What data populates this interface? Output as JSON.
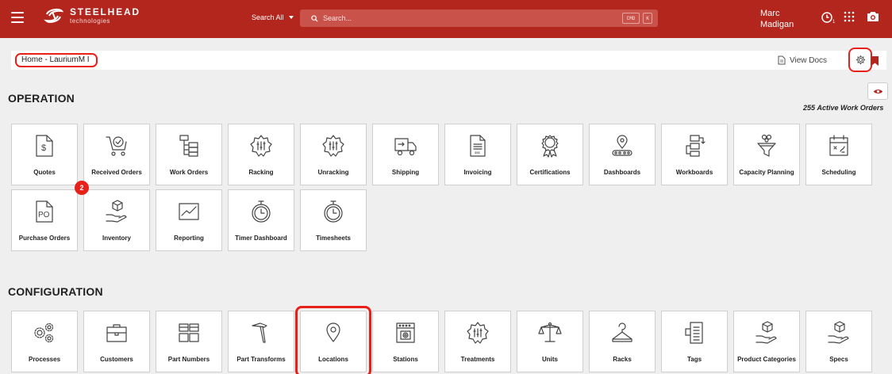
{
  "header": {
    "logo_name": "STEELHEAD",
    "logo_sub": "technologies",
    "search_scope": "Search All",
    "search_placeholder": "Search...",
    "kbd_cmd": "CMD",
    "kbd_k": "K",
    "user_first": "Marc",
    "user_last": "Madigan",
    "clock_count": "1",
    "colors": {
      "brand": "#b3261e"
    }
  },
  "breadcrumb": {
    "label": "Home - LauriumM I"
  },
  "toolbar": {
    "view_docs": "View Docs"
  },
  "operation": {
    "title": "OPERATION",
    "active_count": "255",
    "active_label": "Active Work Orders",
    "tiles": [
      {
        "label": "Quotes",
        "icon": "quote-doc-icon"
      },
      {
        "label": "Received Orders",
        "icon": "cart-check-icon"
      },
      {
        "label": "Work Orders",
        "icon": "tree-list-icon"
      },
      {
        "label": "Racking",
        "icon": "gear-sliders-icon"
      },
      {
        "label": "Unracking",
        "icon": "gear-sliders-icon"
      },
      {
        "label": "Shipping",
        "icon": "truck-icon"
      },
      {
        "label": "Invoicing",
        "icon": "invoice-icon"
      },
      {
        "label": "Certifications",
        "icon": "certificate-icon"
      },
      {
        "label": "Dashboards",
        "icon": "conveyor-pin-icon"
      },
      {
        "label": "Workboards",
        "icon": "workboard-icon"
      },
      {
        "label": "Capacity Planning",
        "icon": "funnel-icon"
      },
      {
        "label": "Scheduling",
        "icon": "calendar-icon"
      },
      {
        "label": "Purchase Orders",
        "icon": "po-icon"
      },
      {
        "label": "Inventory",
        "icon": "hand-box-icon",
        "badge": "2"
      },
      {
        "label": "Reporting",
        "icon": "chart-icon"
      },
      {
        "label": "Timer Dashboard",
        "icon": "stopwatch-icon"
      },
      {
        "label": "Timesheets",
        "icon": "stopwatch-icon"
      }
    ]
  },
  "configuration": {
    "title": "CONFIGURATION",
    "tiles": [
      {
        "label": "Processes",
        "icon": "gears-icon"
      },
      {
        "label": "Customers",
        "icon": "briefcase-icon"
      },
      {
        "label": "Part Numbers",
        "icon": "parts-icon"
      },
      {
        "label": "Part Transforms",
        "icon": "hammer-icon"
      },
      {
        "label": "Locations",
        "icon": "location-pin-icon"
      },
      {
        "label": "Stations",
        "icon": "station-icon"
      },
      {
        "label": "Treatments",
        "icon": "gear-sliders-icon"
      },
      {
        "label": "Units",
        "icon": "scale-icon"
      },
      {
        "label": "Racks",
        "icon": "hanger-icon"
      },
      {
        "label": "Tags",
        "icon": "tags-icon"
      },
      {
        "label": "Product Categories",
        "icon": "hand-box-icon"
      },
      {
        "label": "Specs",
        "icon": "hand-box-icon"
      }
    ]
  }
}
